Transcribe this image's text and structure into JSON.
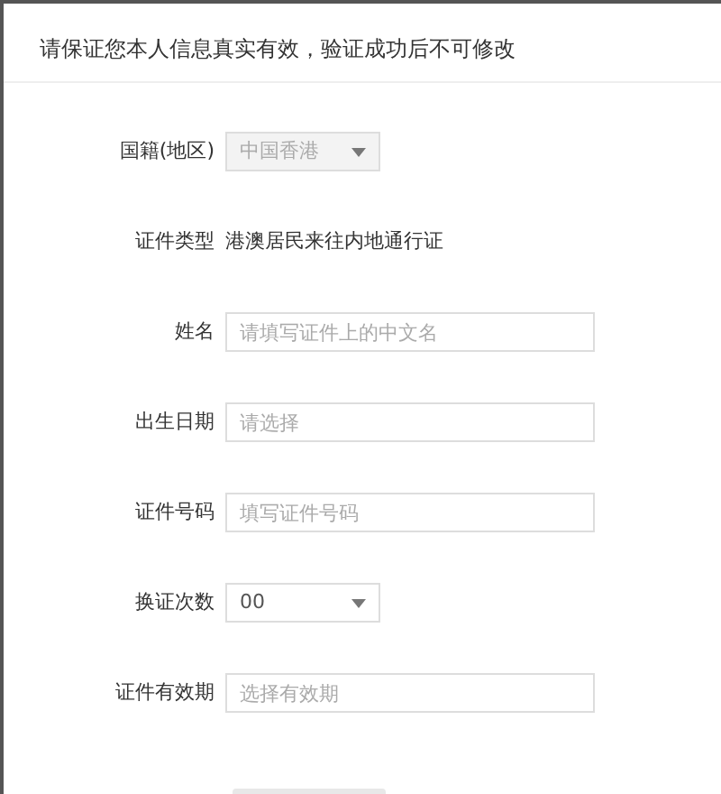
{
  "notice": "请保证您本人信息真实有效，验证成功后不可修改",
  "fields": [
    {
      "kind": "select",
      "label": "国籍(地区)",
      "value": "中国香港",
      "disabled": true
    },
    {
      "kind": "text",
      "label": "证件类型",
      "value": "港澳居民来往内地通行证"
    },
    {
      "kind": "input",
      "label": "姓名",
      "placeholder": "请填写证件上的中文名"
    },
    {
      "kind": "input",
      "label": "出生日期",
      "placeholder": "请选择"
    },
    {
      "kind": "input",
      "label": "证件号码",
      "placeholder": "填写证件号码"
    },
    {
      "kind": "select",
      "label": "换证次数",
      "value": "00",
      "disabled": false
    },
    {
      "kind": "input",
      "label": "证件有效期",
      "placeholder": "选择有效期"
    }
  ]
}
